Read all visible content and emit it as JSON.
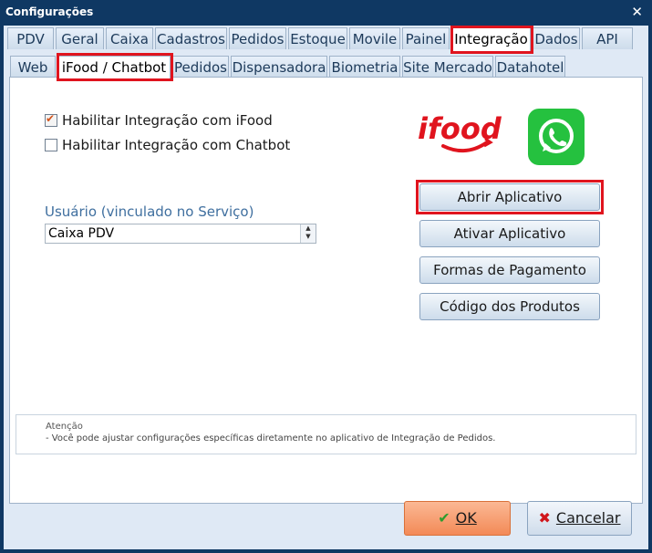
{
  "window": {
    "title": "Configurações"
  },
  "tabs_main": [
    {
      "label": "PDV"
    },
    {
      "label": "Geral"
    },
    {
      "label": "Caixa"
    },
    {
      "label": "Cadastros"
    },
    {
      "label": "Pedidos"
    },
    {
      "label": "Estoque"
    },
    {
      "label": "Movile"
    },
    {
      "label": "Painel"
    },
    {
      "label": "Integração",
      "active": true
    },
    {
      "label": "Dados"
    },
    {
      "label": "API"
    }
  ],
  "tabs_sub": [
    {
      "label": "Web"
    },
    {
      "label": "iFood / Chatbot",
      "active": true
    },
    {
      "label": "Pedidos"
    },
    {
      "label": "Dispensadora"
    },
    {
      "label": "Biometria"
    },
    {
      "label": "Site Mercado"
    },
    {
      "label": "Datahotel"
    }
  ],
  "options": {
    "ifood_label": "Habilitar Integração com iFood",
    "ifood_checked": true,
    "chatbot_label": "Habilitar Integração com Chatbot",
    "chatbot_checked": false
  },
  "user": {
    "label": "Usuário (vinculado no Serviço)",
    "value": "Caixa PDV"
  },
  "logos": {
    "ifood_text": "ifood",
    "whatsapp_icon": "whatsapp-icon",
    "ifood_color": "#e0141e",
    "whatsapp_color": "#25c13f"
  },
  "actions": {
    "open_app": "Abrir Aplicativo",
    "activate_app": "Ativar Aplicativo",
    "payment_methods": "Formas de Pagamento",
    "product_codes": "Código dos Produtos"
  },
  "note": {
    "title": "Atenção",
    "text": "- Você pode ajustar configurações específicas diretamente no aplicativo de Integração de Pedidos."
  },
  "footer": {
    "ok": "OK",
    "cancel": "Cancelar"
  }
}
